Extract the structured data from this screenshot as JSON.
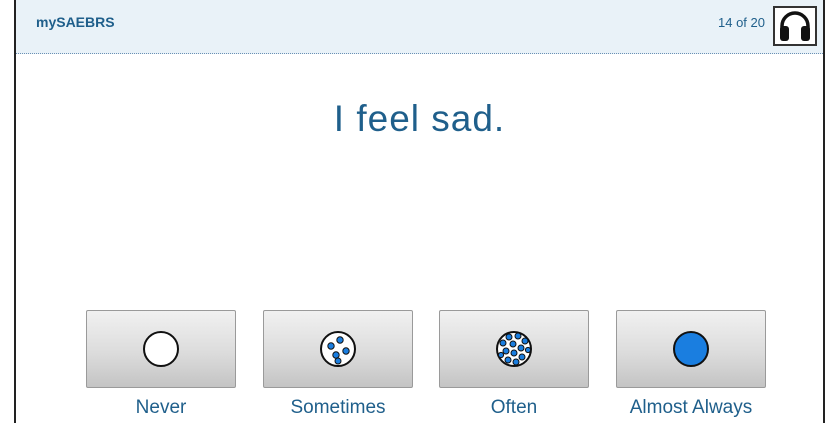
{
  "header": {
    "app_title": "mySAEBRS",
    "progress": "14 of 20",
    "audio_icon": "headphones-icon"
  },
  "question": {
    "text": "I feel sad."
  },
  "choices": [
    {
      "label": "Never",
      "icon": "empty-circle-icon"
    },
    {
      "label": "Sometimes",
      "icon": "few-dots-circle-icon"
    },
    {
      "label": "Often",
      "icon": "many-dots-circle-icon"
    },
    {
      "label": "Almost Always",
      "icon": "filled-circle-icon"
    }
  ],
  "colors": {
    "accent": "#1f5f8b",
    "fill_blue": "#1a7ee0",
    "header_bg": "#e9f2f8"
  }
}
